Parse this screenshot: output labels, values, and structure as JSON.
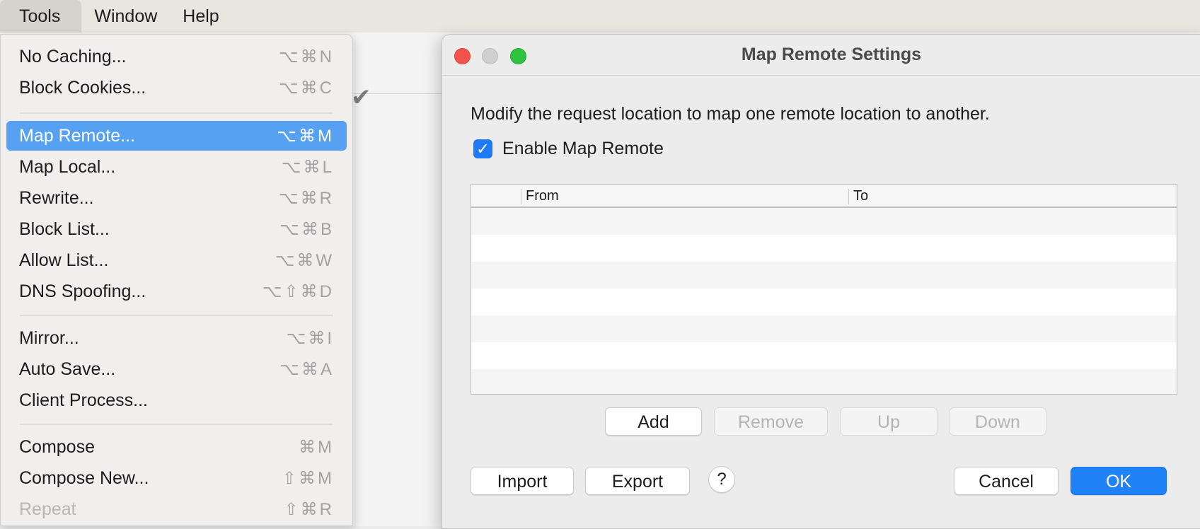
{
  "menubar": {
    "items": [
      {
        "label": "Tools"
      },
      {
        "label": "Window"
      },
      {
        "label": "Help"
      }
    ]
  },
  "tools_menu": {
    "items": [
      {
        "label": "No Caching...",
        "shortcut": "⌥⌘N"
      },
      {
        "label": "Block Cookies...",
        "shortcut": "⌥⌘C"
      },
      {
        "label": "Map Remote...",
        "shortcut": "⌥⌘M",
        "highlighted": true
      },
      {
        "label": "Map Local...",
        "shortcut": "⌥⌘L"
      },
      {
        "label": "Rewrite...",
        "shortcut": "⌥⌘R"
      },
      {
        "label": "Block List...",
        "shortcut": "⌥⌘B"
      },
      {
        "label": "Allow List...",
        "shortcut": "⌥⌘W"
      },
      {
        "label": "DNS Spoofing...",
        "shortcut": "⌥⇧⌘D"
      },
      {
        "label": "Mirror...",
        "shortcut": "⌥⌘I"
      },
      {
        "label": "Auto Save...",
        "shortcut": "⌥⌘A"
      },
      {
        "label": "Client Process...",
        "shortcut": ""
      },
      {
        "label": "Compose",
        "shortcut": "⌘M"
      },
      {
        "label": "Compose New...",
        "shortcut": "⇧⌘M"
      },
      {
        "label": "Repeat",
        "shortcut": "⇧⌘R",
        "disabled": true
      }
    ]
  },
  "background": {
    "check_icon": "✔"
  },
  "dialog": {
    "title": "Map Remote Settings",
    "description": "Modify the request location to map one remote location to another.",
    "enable_label": "Enable Map Remote",
    "enable_checked": true,
    "check_glyph": "✓",
    "table": {
      "columns": [
        "",
        "From",
        "To"
      ],
      "rows": []
    },
    "buttons": {
      "add": "Add",
      "remove": "Remove",
      "up": "Up",
      "down": "Down",
      "import": "Import",
      "export": "Export",
      "help": "?",
      "cancel": "Cancel",
      "ok": "OK"
    }
  },
  "colors": {
    "accent": "#1f82f7",
    "menu_highlight": "#57a1f3",
    "close": "#f4534d",
    "zoom": "#2fc440"
  }
}
